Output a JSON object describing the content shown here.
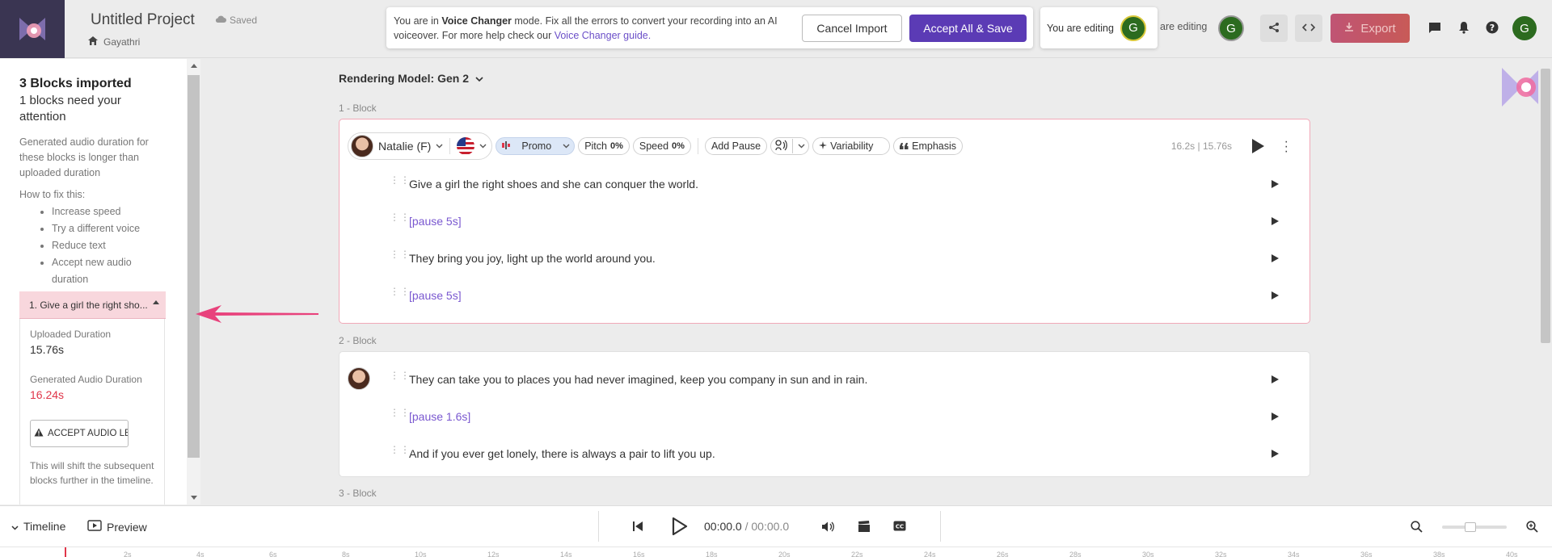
{
  "header": {
    "project_title": "Untitled Project",
    "saved_label": "Saved",
    "user_name": "Gayathri",
    "avatar_initial": "G",
    "editing_label": "You are editing",
    "editing_label_2": "are editing",
    "export_label": "Export"
  },
  "banner": {
    "text_prefix": "You are in ",
    "mode": "Voice Changer",
    "text_mid": " mode. Fix all the errors to convert your recording into an AI voiceover. For more help check our ",
    "guide_link": "Voice Changer guide.",
    "cancel_label": "Cancel Import",
    "accept_label": "Accept All & Save"
  },
  "sidebar": {
    "title": "3 Blocks imported",
    "subtitle": "1 blocks need your attention",
    "description": "Generated audio duration for these blocks is longer than uploaded duration",
    "how_to": "How to fix this:",
    "fixes": [
      "Increase speed",
      "Try a different voice",
      "Reduce text",
      "Accept new audio duration"
    ],
    "card": {
      "header": "1. Give a girl the right sho...",
      "uploaded_label": "Uploaded Duration",
      "uploaded_value": "15.76s",
      "generated_label": "Generated Audio Duration",
      "generated_value": "16.24s",
      "accept_button": "ACCEPT AUDIO LENGTH",
      "note": "This will shift the subsequent blocks further in the timeline."
    }
  },
  "main": {
    "rendering_model": "Rendering Model: Gen 2",
    "blocks": [
      {
        "label": "1 -  Block",
        "voice": "Natalie (F)",
        "style": "Promo",
        "pitch_label": "Pitch",
        "pitch_value": "0%",
        "speed_label": "Speed",
        "speed_value": "0%",
        "add_pause": "Add Pause",
        "variability": "Variability",
        "emphasis": "Emphasis",
        "duration": "16.2s | 15.76s",
        "lines": [
          {
            "text": "Give a girl the right shoes and she can conquer the world.",
            "pause": false
          },
          {
            "text": "[pause 5s]",
            "pause": true
          },
          {
            "text": "They bring you joy, light up the world around you.",
            "pause": false
          },
          {
            "text": "[pause 5s]",
            "pause": true
          }
        ]
      },
      {
        "label": "2 -  Block",
        "lines": [
          {
            "text": "They can take you to places you had never imagined, keep you company in sun and in rain.",
            "pause": false
          },
          {
            "text": "[pause 1.6s]",
            "pause": true
          },
          {
            "text": "And if you ever get lonely, there is always a pair to lift you up.",
            "pause": false
          }
        ]
      },
      {
        "label": "3 -  Block"
      }
    ]
  },
  "bottom": {
    "timeline_label": "Timeline",
    "preview_label": "Preview",
    "current_time": "00:00.0",
    "total_time": "/ 00:00.0"
  },
  "ruler_ticks": [
    "2s",
    "4s",
    "6s",
    "8s",
    "10s",
    "12s",
    "14s",
    "16s",
    "18s",
    "20s",
    "22s",
    "24s",
    "26s",
    "28s",
    "30s",
    "32s",
    "34s",
    "36s",
    "38s",
    "40s"
  ],
  "colors": {
    "accent": "#5b3bb5",
    "error": "#e0364a",
    "pause_text": "#7a58d0",
    "arrow": "#e8427c"
  }
}
